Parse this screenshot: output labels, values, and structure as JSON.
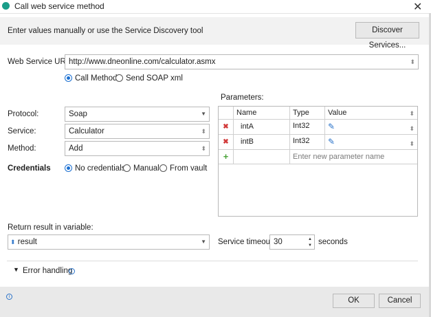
{
  "window": {
    "title": "Call web service method",
    "close_glyph": "✕"
  },
  "banner": {
    "text": "Enter values manually or use the Service Discovery tool",
    "discover_label": "Discover Services..."
  },
  "url": {
    "label": "Web Service URL:",
    "value": "http://www.dneonline.com/calculator.asmx"
  },
  "mode": {
    "call_method": "Call Method",
    "send_soap": "Send SOAP xml",
    "selected": "call_method"
  },
  "parameters": {
    "label": "Parameters:",
    "columns": [
      "Name",
      "Type",
      "Value"
    ],
    "rows": [
      {
        "name": "intA",
        "type": "Int32",
        "value": ""
      },
      {
        "name": "intB",
        "type": "Int32",
        "value": ""
      }
    ],
    "new_placeholder": "Enter new parameter name"
  },
  "protocol": {
    "label": "Protocol:",
    "value": "Soap"
  },
  "service": {
    "label": "Service:",
    "value": "Calculator"
  },
  "method": {
    "label": "Method:",
    "value": "Add"
  },
  "credentials": {
    "label": "Credentials",
    "options": [
      "No credentials",
      "Manual",
      "From vault"
    ],
    "selected": "No credentials"
  },
  "return": {
    "label": "Return result in variable:",
    "value": "result"
  },
  "timeout": {
    "label": "Service timeout:",
    "value": "30",
    "unit": "seconds"
  },
  "error_handling": {
    "label": "Error handling"
  },
  "footer": {
    "ok_label": "OK",
    "cancel_label": "Cancel"
  },
  "colors": {
    "accent": "#1a6fd1",
    "delete": "#d23a3a",
    "add": "#4aa33a",
    "banner": "#f2f2f2",
    "footer": "#e9e9e9"
  },
  "icons": {
    "app": "app-logo-icon",
    "pin": "pin-icon",
    "edit": "pencil-icon",
    "info": "info-icon"
  }
}
